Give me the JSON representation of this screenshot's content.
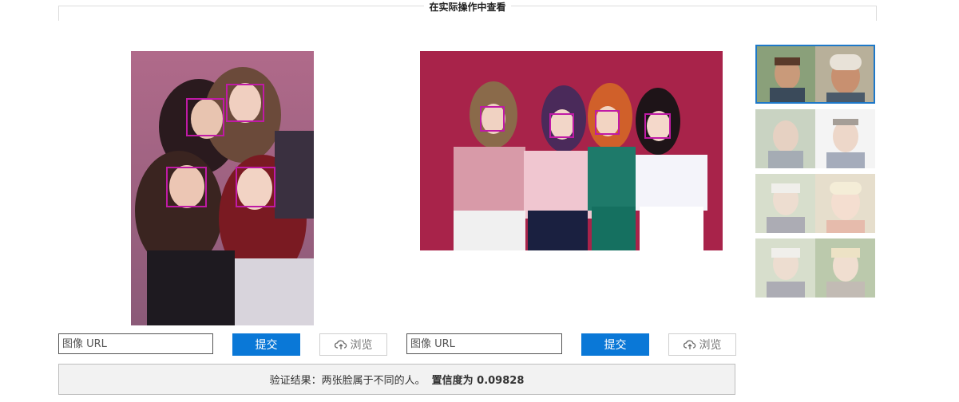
{
  "section": {
    "title": "在实际操作中查看"
  },
  "left_panel": {
    "url_placeholder": "图像 URL",
    "submit_label": "提交",
    "browse_label": "浏览"
  },
  "right_panel": {
    "url_placeholder": "图像 URL",
    "submit_label": "提交",
    "browse_label": "浏览"
  },
  "result": {
    "text": "验证结果：两张脸属于不同的人。",
    "confidence": "置信度为 0.09828"
  },
  "colors": {
    "accent": "#0a78d7",
    "face_box": "#c01aa6",
    "selected_border": "#1e78c8"
  }
}
